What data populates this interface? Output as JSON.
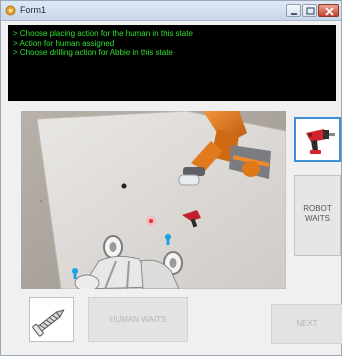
{
  "window": {
    "title": "Form1"
  },
  "console": {
    "lines": [
      "> Choose placing action for the human in this state",
      "> Action for human assigned",
      "> Choose drilling action for Abbie in this state"
    ]
  },
  "right_panel": {
    "tool_icon": "drill-icon",
    "robot_button": {
      "line1": "ROBOT",
      "line2": "WAITS"
    }
  },
  "bottom": {
    "screw_icon": "screw-icon",
    "human_waits_label": "HUMAN WAITS",
    "next_label": "NEXT"
  },
  "colors": {
    "console_text": "#2fe02f",
    "console_bg": "#000000",
    "selected_border": "#3f8fd6",
    "robot_arm": "#e0781a"
  }
}
